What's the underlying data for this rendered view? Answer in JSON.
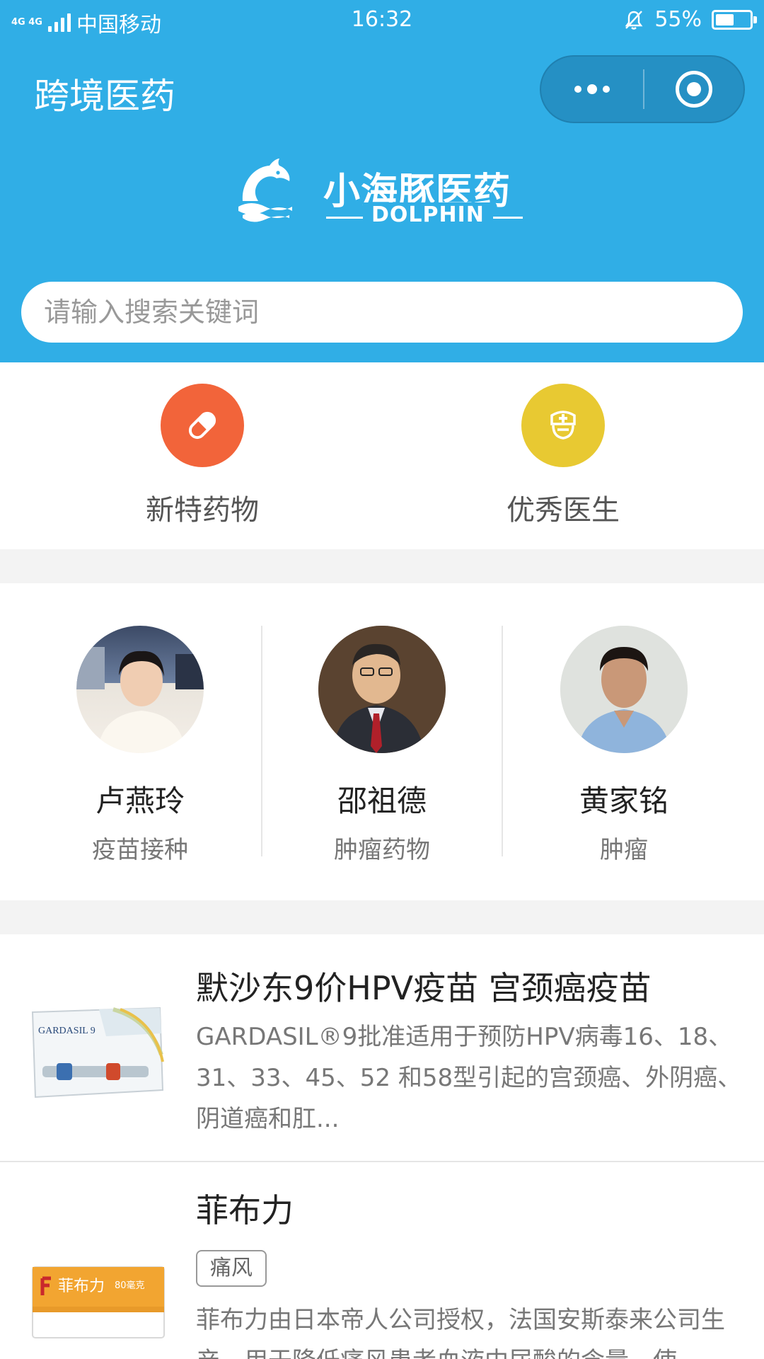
{
  "status_bar": {
    "network": "4G 4G",
    "carrier": "中国移动",
    "time": "16:32",
    "battery": "55%",
    "battery_level": 0.55
  },
  "header": {
    "title": "跨境医药",
    "logo_cn": "小海豚医药",
    "logo_en": "DOLPHIN",
    "bg_color": "#30aee6"
  },
  "search": {
    "placeholder": "请输入搜索关键词"
  },
  "categories": [
    {
      "label": "新特药物",
      "icon": "pill-icon",
      "color": "#f2643a"
    },
    {
      "label": "优秀医生",
      "icon": "doctor-icon",
      "color": "#e8c932"
    }
  ],
  "doctors": [
    {
      "name": "卢燕玲",
      "field": "疫苗接种"
    },
    {
      "name": "邵祖德",
      "field": "肿瘤药物"
    },
    {
      "name": "黄家铭",
      "field": "肿瘤"
    }
  ],
  "products": [
    {
      "title": "默沙东9价HPV疫苗 宫颈癌疫苗",
      "description": "GARDASIL®9批准适用于预防HPV病毒16、18、31、33、45、52 和58型引起的宫颈癌、外阴癌、阴道癌和肛...",
      "box_brand": "GARDASIL 9"
    },
    {
      "title": "菲布力",
      "tag": "痛风",
      "description": "菲布力由日本帝人公司授权，法国安斯泰来公司生产，用于降低痛风患者血液中尿酸的含量，使",
      "box_brand": "菲布力",
      "box_dose": "80毫克"
    }
  ]
}
